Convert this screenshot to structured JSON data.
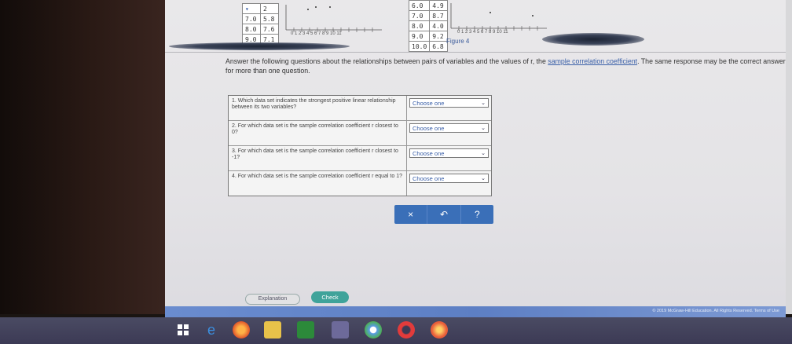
{
  "left_table": {
    "rows": [
      [
        "",
        "2"
      ],
      [
        "7.0",
        "5.8"
      ],
      [
        "8.0",
        "7.6"
      ],
      [
        "9.0",
        "7.1"
      ]
    ]
  },
  "left_graph_ticks": "0 1 2 3 4 5 6 7 8 9 10 11",
  "right_table": {
    "rows": [
      [
        "6.0",
        "4.9"
      ],
      [
        "7.0",
        "8.7"
      ],
      [
        "8.0",
        "4.0"
      ],
      [
        "9.0",
        "9.2"
      ],
      [
        "10.0",
        "6.8"
      ]
    ]
  },
  "right_graph_ticks": "0 1 2 3 4 5 6 7 8 9 10 11",
  "figure_label": "Figure 4",
  "prompt": {
    "text_before": "Answer the following questions about the relationships between pairs of variables and the values of r, the ",
    "link": "sample correlation coefficient",
    "text_after": ". The same response may be the correct answer for more than one question."
  },
  "questions": [
    {
      "text": "1. Which data set indicates the strongest positive linear relationship between its two variables?",
      "selected": "Choose one"
    },
    {
      "text": "2. For which data set is the sample correlation coefficient r closest to 0?",
      "selected": "Choose one"
    },
    {
      "text": "3. For which data set is the sample correlation coefficient r closest to -1?",
      "selected": "Choose one"
    },
    {
      "text": "4. For which data set is the sample correlation coefficient r equal to 1?",
      "selected": "Choose one"
    }
  ],
  "actions": {
    "clear": "×",
    "undo": "↶",
    "help": "?"
  },
  "buttons": {
    "explanation": "Explanation",
    "check": "Check"
  },
  "copyright": "© 2019 McGraw-Hill Education. All Rights Reserved.   Terms of Use",
  "colors": {
    "accent": "#3a6fb8",
    "check": "#3fa39a",
    "link": "#3a5fa8"
  },
  "taskbar_icons": [
    "windows-icon",
    "edge-icon",
    "firefox-icon",
    "file-explorer-icon",
    "store-icon",
    "photos-icon",
    "chrome-icon",
    "opera-icon",
    "app-icon"
  ]
}
